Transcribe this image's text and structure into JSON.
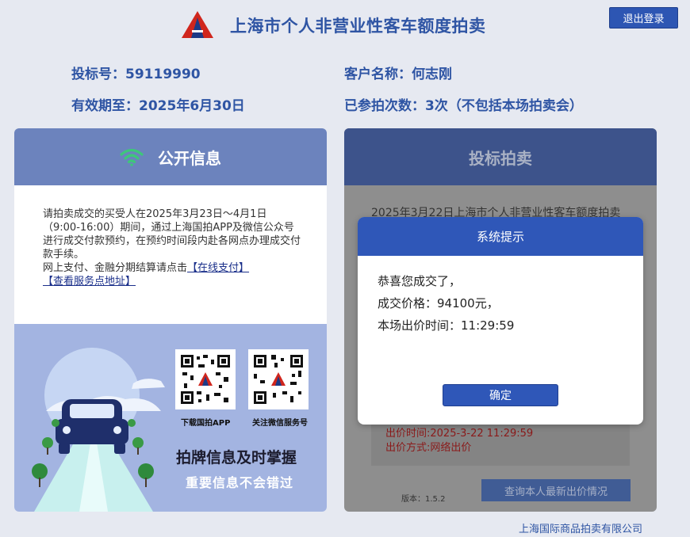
{
  "header": {
    "title": "上海市个人非营业性客车额度拍卖",
    "logout_label": "退出登录"
  },
  "user_info": {
    "bid_no_label": "投标号：",
    "bid_no": "59119990",
    "customer_label": "客户名称：",
    "customer_name": "何志刚",
    "valid_label": "有效期至：",
    "valid_until": "2025年6月30日",
    "count_label": "已参拍次数：",
    "count_value": "3次（不包括本场拍卖会）"
  },
  "public_panel": {
    "title": "公开信息",
    "notice": "请拍卖成交的买受人在2025年3月23日～4月1日（9:00-16:00）期间，通过上海国拍APP及微信公众号进行成交付款预约，在预约时间段内赴各网点办理成交付款手续。",
    "online_text": "网上支付、金融分期结算请点击",
    "online_link": "【在线支付】",
    "service_link": "【查看服务点地址】",
    "qr_app_label": "下载国拍APP",
    "qr_wechat_label": "关注微信服务号",
    "slogan_main": "拍牌信息及时掌握",
    "slogan_sub": "重要信息不会错过"
  },
  "bid_panel": {
    "title": "投标拍卖",
    "auction_title": "2025年3月22日上海市个人非营业性客车额度拍卖",
    "bid_time": "出价时间:2025-3-22 11:29:59",
    "bid_method": "出价方式:网络出价",
    "version": "版本：1.5.2",
    "query_button": "查询本人最新出价情况"
  },
  "dialog": {
    "title": "系统提示",
    "line1": "恭喜您成交了，",
    "line2": "成交价格：94100元，",
    "line3": "本场出价时间：11:29:59",
    "ok_label": "确定"
  },
  "footer": {
    "company": "上海国际商品拍卖有限公司"
  },
  "colors": {
    "brand_blue": "#2f55a4",
    "button_blue": "#2f57b8",
    "panel_header": "#6c83bd",
    "promo_bg": "#a3b4e1",
    "wifi_green": "#3ec77a",
    "logo_red": "#d0261d"
  },
  "icons": {
    "logo": "auction-logo-icon",
    "wifi": "wifi-icon",
    "car": "car-illustration"
  }
}
